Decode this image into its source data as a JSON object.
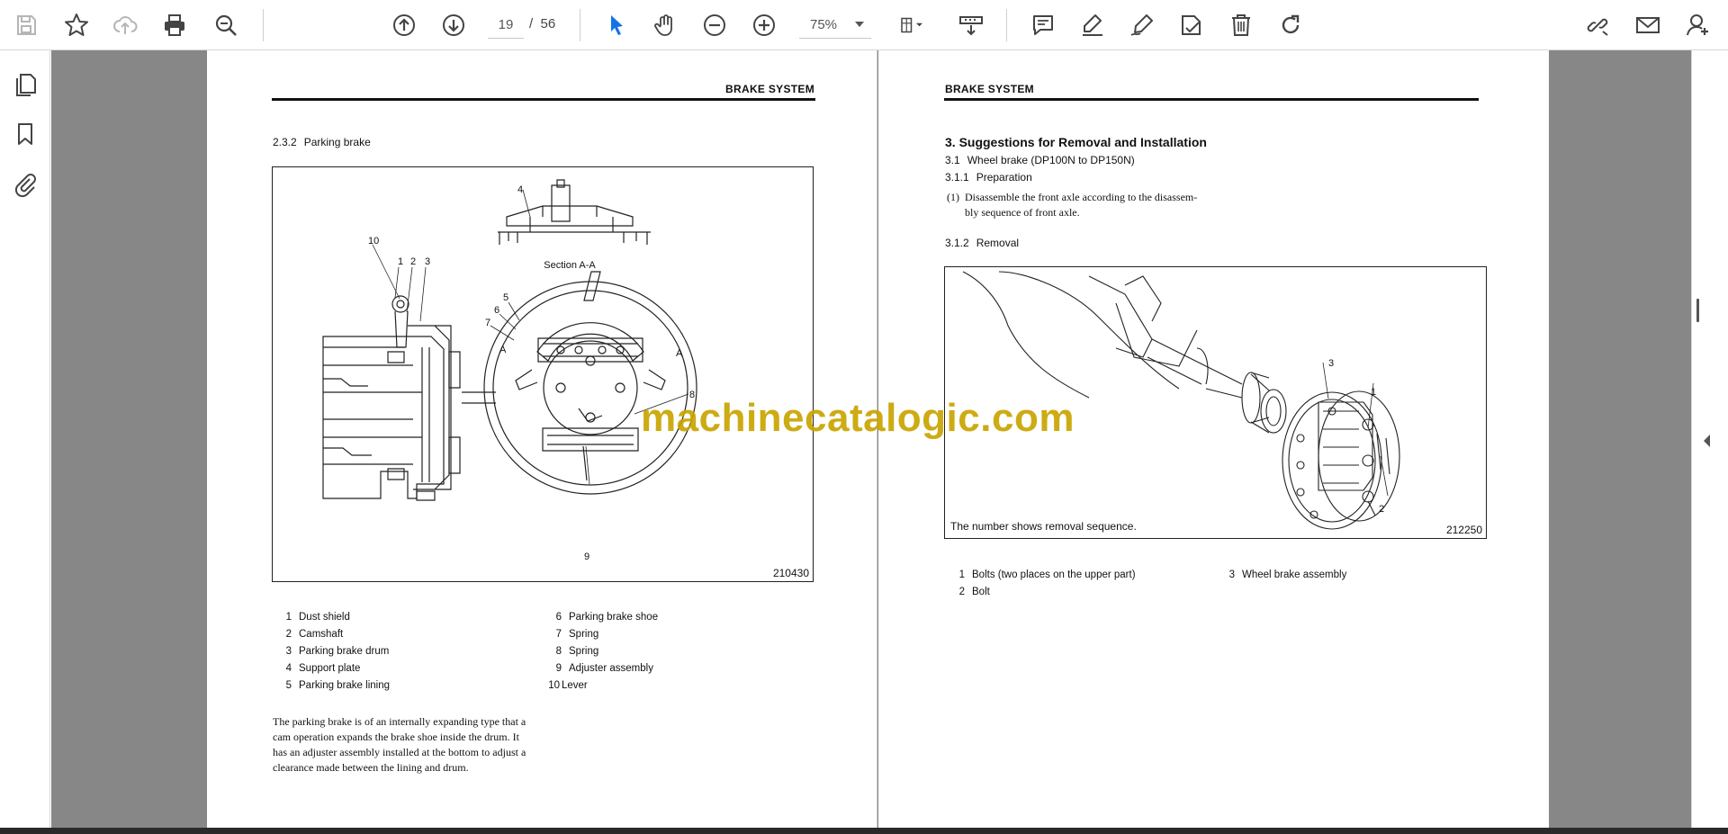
{
  "toolbar": {
    "page_current": "19",
    "page_separator": "/",
    "page_total": "56",
    "zoom": "75%"
  },
  "left_page": {
    "header": "BRAKE SYSTEM",
    "section_num": "2.3.2",
    "section_title": "Parking brake",
    "figure": {
      "code": "210430",
      "section_label": "Section A-A",
      "callouts": [
        "1",
        "2",
        "3",
        "4",
        "5",
        "6",
        "7",
        "8",
        "9",
        "10",
        "A",
        "A"
      ]
    },
    "legend": [
      {
        "num": "1",
        "text": "Dust shield"
      },
      {
        "num": "2",
        "text": "Camshaft"
      },
      {
        "num": "3",
        "text": "Parking brake drum"
      },
      {
        "num": "4",
        "text": "Support plate"
      },
      {
        "num": "5",
        "text": "Parking brake lining"
      },
      {
        "num": "6",
        "text": "Parking brake shoe"
      },
      {
        "num": "7",
        "text": "Spring"
      },
      {
        "num": "8",
        "text": "Spring"
      },
      {
        "num": "9",
        "text": "Adjuster assembly"
      },
      {
        "num": "10",
        "text": "Lever"
      }
    ],
    "paragraph": [
      "The parking brake is of an internally expanding type that a",
      "cam operation expands the brake shoe inside the drum. It",
      "has an adjuster assembly installed at the bottom to adjust a",
      "clearance made between the lining and drum."
    ]
  },
  "right_page": {
    "header": "BRAKE SYSTEM",
    "title": "3. Suggestions for Removal and Installation",
    "sub1_num": "3.1",
    "sub1_title": "Wheel brake (DP100N to DP150N)",
    "sub2_num": "3.1.1",
    "sub2_title": "Preparation",
    "step_num": "(1)",
    "step_lines": [
      "Disassemble the front axle according to the disassem-",
      "bly sequence of front axle."
    ],
    "sub3_num": "3.1.2",
    "sub3_title": "Removal",
    "figure": {
      "caption": "The number shows removal sequence.",
      "code": "212250",
      "callouts": [
        "3",
        "1",
        "2"
      ]
    },
    "legend": [
      {
        "num": "1",
        "text": "Bolts (two places on the upper part)"
      },
      {
        "num": "3",
        "text": "Wheel brake assembly"
      },
      {
        "num": "2",
        "text": "Bolt"
      }
    ]
  },
  "watermark": "machinecatalogic.com",
  "icons": {
    "left_toolbar": [
      "save-icon",
      "bookmark-star-icon",
      "cloud-upload-icon",
      "print-icon",
      "zoom-out-search-icon",
      "page-up-icon",
      "page-down-icon"
    ],
    "mid_toolbar": [
      "select-cursor-icon",
      "hand-pan-icon",
      "zoom-out-icon",
      "zoom-in-icon",
      "fit-page-icon",
      "scroll-mode-icon"
    ],
    "right_toolbar": [
      "comment-icon",
      "highlight-icon",
      "draw-icon",
      "stamp-icon",
      "delete-icon",
      "rotate-icon",
      "share-link-icon",
      "email-icon",
      "add-user-icon"
    ],
    "rail": [
      "pages-thumbnail-icon",
      "bookmark-icon",
      "attachment-icon"
    ]
  },
  "colors": {
    "accent": "#1473e6",
    "viewer_bg": "#878787",
    "watermark": "#c9a400"
  }
}
